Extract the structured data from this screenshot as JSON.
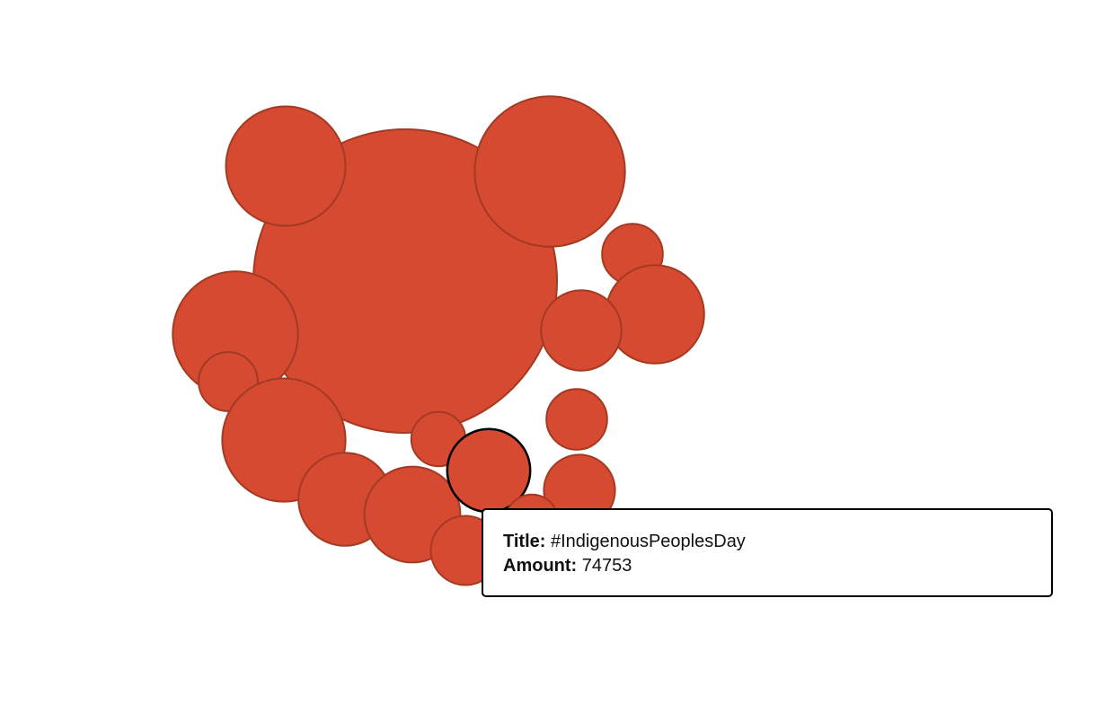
{
  "chart_data": {
    "type": "bubble",
    "fill_color": "#d64a31",
    "stroke_color": "#a33a22",
    "highlight_stroke_color": "#000000",
    "bubbles": [
      {
        "amount": 1000000
      },
      {
        "amount": 155000
      },
      {
        "amount": 245000
      },
      {
        "amount": 40000
      },
      {
        "amount": 105000
      },
      {
        "amount": 70000
      },
      {
        "amount": 170000
      },
      {
        "amount": 38000
      },
      {
        "amount": 40000
      },
      {
        "amount": 165000
      },
      {
        "amount": 94000
      },
      {
        "amount": 100000
      },
      {
        "amount": 32000
      },
      {
        "amount": 74753,
        "title": "#IndigenousPeoplesDay",
        "highlighted": true
      },
      {
        "amount": 55000
      },
      {
        "amount": 52000
      },
      {
        "amount": 30000
      }
    ]
  },
  "tooltip": {
    "title_label": "Title:",
    "title_value": "#IndigenousPeoplesDay",
    "amount_label": "Amount:",
    "amount_value": "74753"
  }
}
